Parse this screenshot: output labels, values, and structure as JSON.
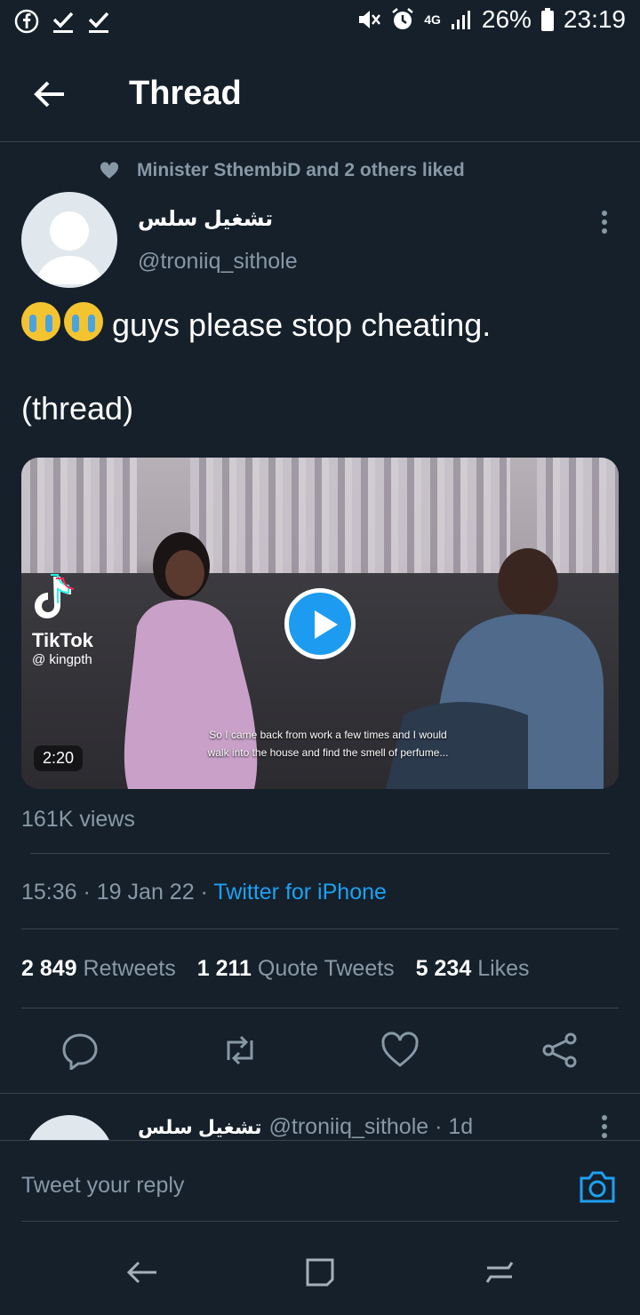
{
  "status_bar": {
    "battery": "26%",
    "time": "23:19",
    "network": "4G"
  },
  "header": {
    "title": "Thread"
  },
  "liked": {
    "text": "Minister SthembiD and 2 others liked"
  },
  "tweet": {
    "author_name": "تشغيل سلس",
    "handle": "@troniiq_sithole",
    "line1": "guys please stop cheating.",
    "line2": "(thread)",
    "video": {
      "brand": "TikTok",
      "brand_user": "@ kingpth",
      "caption_line1": "So I came back from work a few times and I would",
      "caption_line2": "walk into the house and find the smell of perfume...",
      "duration": "2:20"
    },
    "views": "161K views",
    "time": "15:36",
    "date": "19 Jan 22",
    "source": "Twitter for iPhone",
    "retweets_count": "2 849",
    "retweets_label": "Retweets",
    "quotes_count": "1 211",
    "quotes_label": "Quote Tweets",
    "likes_count": "5 234",
    "likes_label": "Likes"
  },
  "next_tweet": {
    "author_name": "تشغيل سلس",
    "handle_time": "@troniiq_sithole · 1d"
  },
  "reply": {
    "placeholder": "Tweet your reply"
  },
  "colors": {
    "background": "#15202b",
    "accent": "#1da1f2",
    "muted": "#8899a6",
    "divider": "#38444d"
  }
}
